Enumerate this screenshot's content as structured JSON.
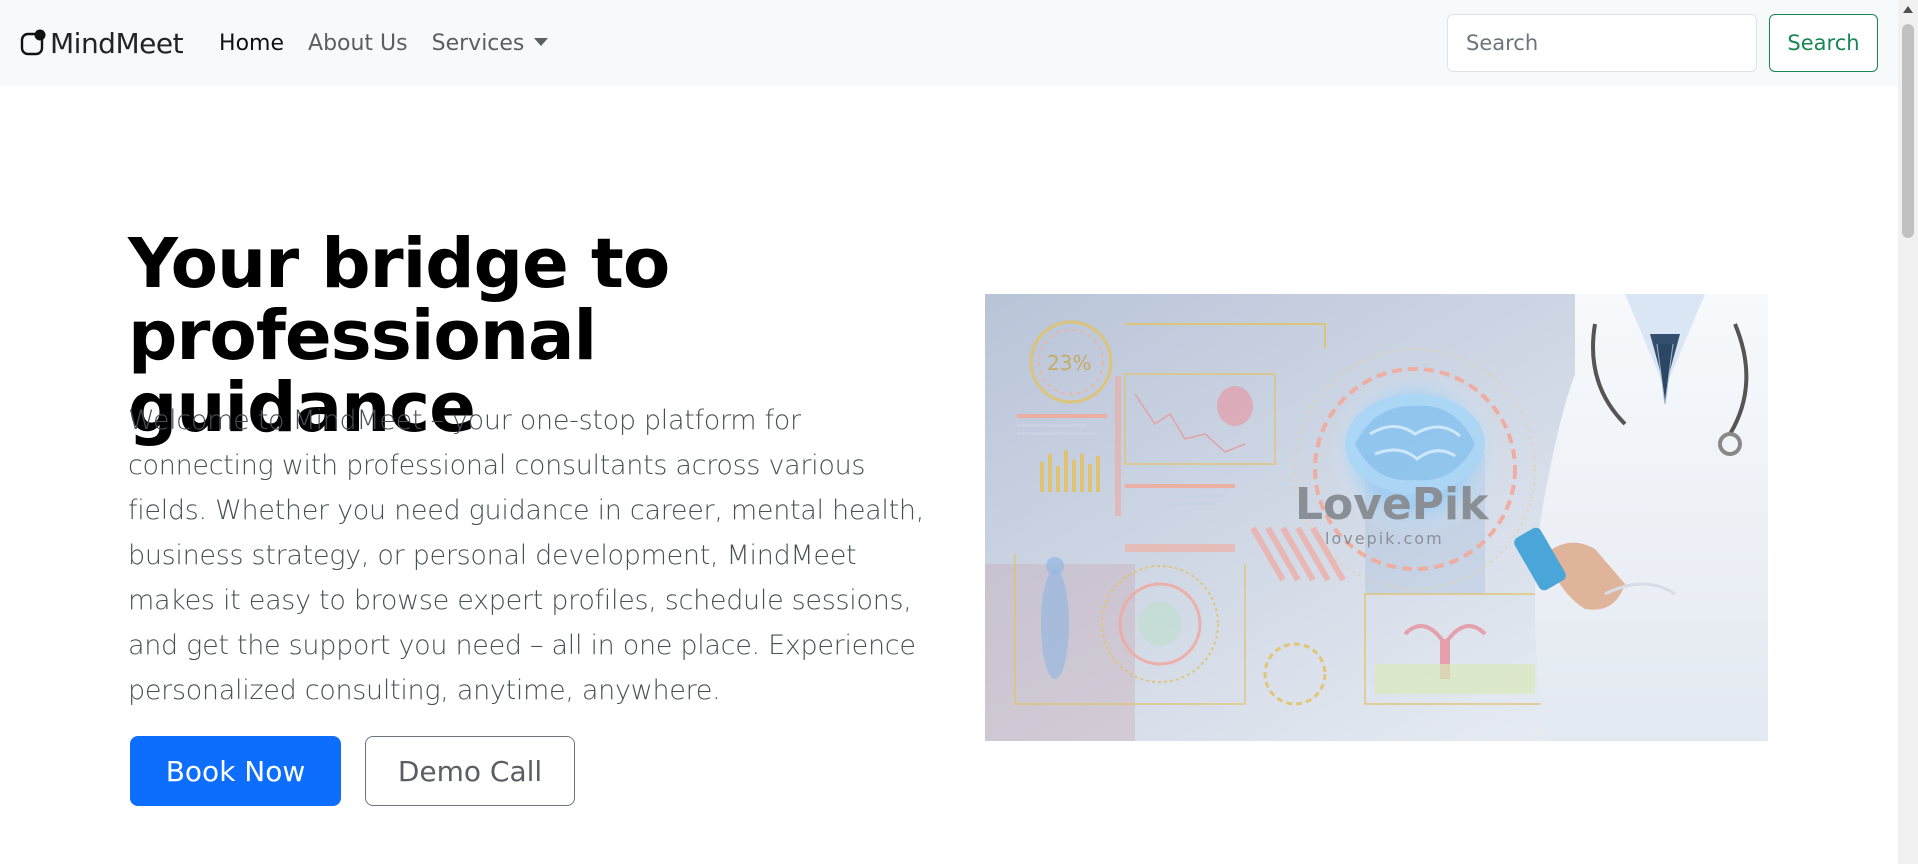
{
  "brand": {
    "name": "MindMeet",
    "icon": "logo-icon"
  },
  "nav": {
    "items": [
      {
        "label": "Home",
        "active": true
      },
      {
        "label": "About Us",
        "active": false
      },
      {
        "label": "Services",
        "active": false,
        "dropdown": true
      }
    ]
  },
  "search": {
    "placeholder": "Search",
    "button_label": "Search"
  },
  "hero": {
    "title_line1": "Your bridge to",
    "title_line2": "professional guidance",
    "text": "Welcome to MindMeet – your one-stop platform for connecting with professional consultants across various fields. Whether you need guidance in career, mental health, business strategy, or personal development, MindMeet makes it easy to browse expert profiles, schedule sessions, and get the support you need – all in one place. Experience personalized consulting, anytime, anywhere.",
    "primary_button": "Book Now",
    "secondary_button": "Demo Call"
  },
  "image": {
    "watermark": "LovePik",
    "watermark_url": "lovepik.com",
    "percentage": "23%"
  },
  "colors": {
    "navbar_bg": "#f8f9fa",
    "primary": "#0d6efd",
    "success": "#198754",
    "secondary": "#6c757d"
  }
}
